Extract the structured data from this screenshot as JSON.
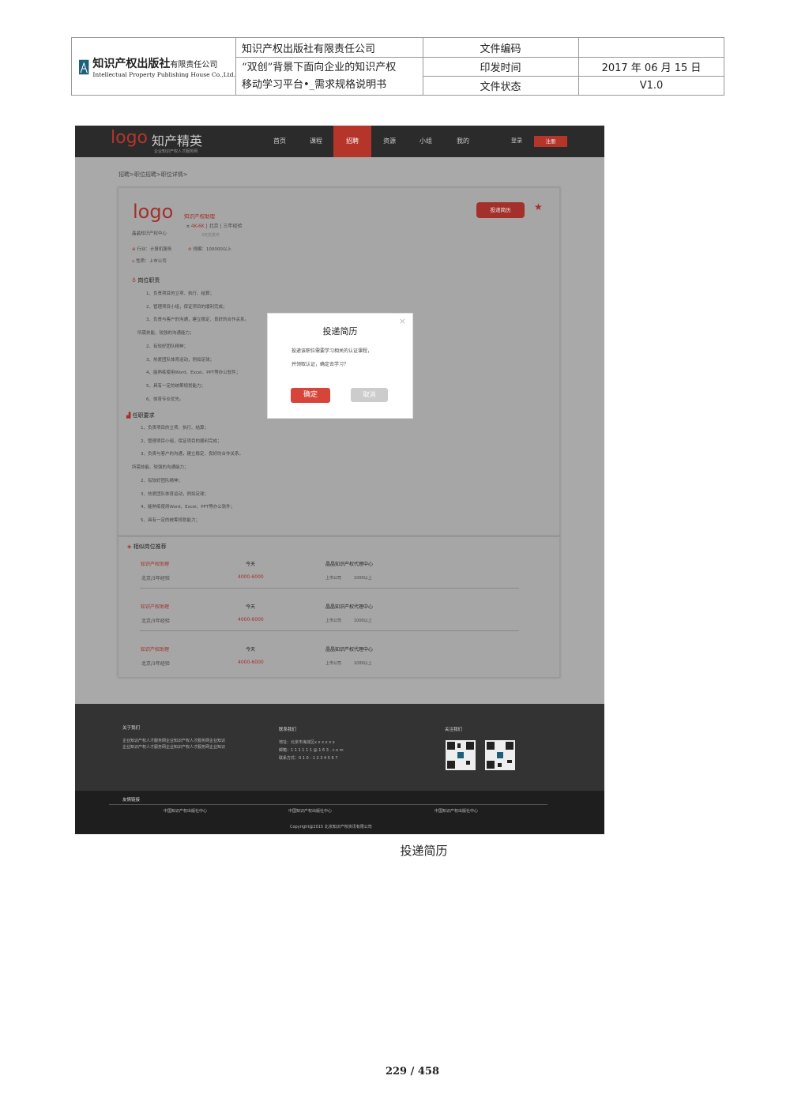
{
  "doc_header": {
    "company_name": "知识产权出版社有限责任公司",
    "logo_cn": "知识产权出版社",
    "logo_cn_suffix": "有限责任公司",
    "logo_en": "Intellectual Property Publishing House Co.,Ltd.",
    "doc_title_line1": "“双创”背景下面向企业的知识产权",
    "doc_title_line2": "移动学习平台•_需求规格说明书",
    "label_code": "文件编码",
    "value_code": "",
    "label_date": "印发时间",
    "value_date": "2017 年 06 月 15 日",
    "label_status": "文件状态",
    "value_status": "V1.0"
  },
  "site": {
    "logo": "logo",
    "brand": "知产精英",
    "brand_sub": "企业知识产权人才服务网",
    "nav": [
      "首页",
      "课程",
      "招聘",
      "资源",
      "小组",
      "我的"
    ],
    "login": "登录",
    "register": "注册",
    "breadcrumb": "招聘>职位招聘>职位详情>"
  },
  "job": {
    "company_logo": "logo",
    "company_name": "晶晶知识产权中心",
    "title": "知识产权助理",
    "salary": "4K-6K",
    "city": "北京",
    "experience": "三年经验",
    "posted": "3天前发布",
    "industry": "行业：计算机服务",
    "scale": "规模：100000以上",
    "nature": "性质：上市公司",
    "apply_button": "投递简历",
    "duty_title": "岗位职责",
    "duties": [
      "1、负责项目的立项、执行、结算；",
      "2、管理项目小组，保证项目的顺利完成；",
      "3、负责与客户的沟通，建立稳定、良好的合作关系。",
      "所需技能、较强的沟通能力；",
      "2、有较好团队精神；",
      "3、热爱团队体育运动，例如足球；",
      "4、能熟练使用Word、Excel、PPT等办公软件；",
      "5、具有一定的统筹规划能力；",
      "6、体育专业优先。"
    ],
    "req_title": "任职要求",
    "requirements": [
      "1、负责项目的立项、执行、结算；",
      "2、管理项目小组，保证项目的顺利完成；",
      "3、负责与客户的沟通，建立稳定、良好的合作关系。",
      "所需技能、较强的沟通能力；",
      "2、有较好团队精神；",
      "3、热爱团队体育运动，例如足球；",
      "4、能熟练使用Word、Excel、PPT等办公软件；",
      "5、具有一定的统筹规划能力；"
    ]
  },
  "similar": {
    "title": "相似岗位推荐",
    "items": [
      {
        "title": "知识产权助理",
        "location": "北京/3年经验",
        "date": "今天",
        "salary": "4000-6000",
        "company": "晶晶知识产权代理中心",
        "type": "上市公司",
        "scale": "1000以上"
      },
      {
        "title": "知识产权助理",
        "location": "北京/3年经验",
        "date": "今天",
        "salary": "4000-6000",
        "company": "晶晶知识产权代理中心",
        "type": "上市公司",
        "scale": "1000以上"
      },
      {
        "title": "知识产权助理",
        "location": "北京/3年经验",
        "date": "今天",
        "salary": "4000-6000",
        "company": "晶晶知识产权代理中心",
        "type": "上市公司",
        "scale": "1000以上"
      }
    ]
  },
  "dialog": {
    "title": "投递简历",
    "line1": "投递该职位需要学习相关的认证课程，",
    "line2": "并领取认证，确定去学习？",
    "confirm": "确定",
    "cancel": "取消",
    "close": "×"
  },
  "footer": {
    "about_title": "关于我们",
    "about_line1": "企业知识产权人才服务网企业知识产权人才服务网企业知识",
    "about_line2": "企业知识产权人才服务网企业知识产权人才服务网企业知识",
    "contact_title": "联系我们",
    "address": "地址：北京市海淀区x x x x x x",
    "email": "邮箱：1 1 1 1 1 1 @ 1 6 3 . c o m",
    "phone": "联系方式：0 1 0 - 1 2 3 4 5 6 7",
    "follow_title": "关注我们",
    "links_title": "友情链接",
    "links": [
      "中国知识产权出版社中心",
      "中国知识产权出版社中心",
      "中国知识产权出版社中心"
    ],
    "copyright": "Copyright@2015  北京知识产权资讯有限公司"
  },
  "caption": "投递简历",
  "page_number": "229 / 458",
  "colors": {
    "accent": "#b5352a",
    "topbar": "#2b2b2b",
    "overlay_bg": "#a9a9a9"
  }
}
